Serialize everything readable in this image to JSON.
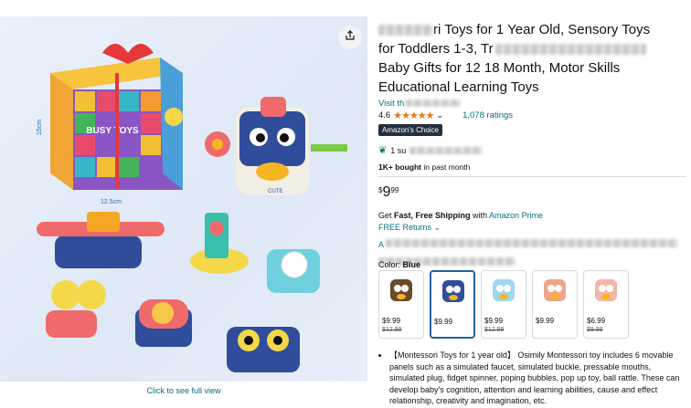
{
  "gallery": {
    "full_view_link": "Click to see full view",
    "share_icon": "share-icon"
  },
  "product": {
    "title": "ri Toys for 1 Year Old, Sensory Toys for Toddlers 1-3, Tr Baby Gifts for 12 18 Month, Motor Skills Educational Learning Toys",
    "title_lines": [
      "ri Toys for 1 Year Old, Sensory Toys",
      "for Toddlers 1-3, Tr",
      "Baby Gifts for 12 18 Month, Motor Skills",
      "Educational Learning Toys"
    ],
    "visit_store": "Visit th",
    "rating_value": "4.6",
    "stars": "★★★★★",
    "ratings_count": "1,078 ratings",
    "badge": "Amazon's Choice",
    "sustainability": "1 su",
    "bought": "1K+ bought",
    "bought_suffix": "in past month",
    "price_currency": "$",
    "price_whole": "9",
    "price_fraction": "99",
    "shipping_prefix": "Get ",
    "shipping_bold": "Fast, Free Shipping",
    "shipping_mid": " with ",
    "shipping_link": "Amazon Prime",
    "returns": "FREE Returns",
    "blurred_prefix": "A",
    "color_label": "Color:",
    "color_value": "Blue",
    "swatches": [
      {
        "price": "$9.99",
        "strike": "$12.99",
        "color": "#6b4a2a"
      },
      {
        "price": "$9.99",
        "strike": "",
        "color": "#2f4d9b"
      },
      {
        "price": "$9.99",
        "strike": "$12.99",
        "color": "#9fd6f0"
      },
      {
        "price": "$9.99",
        "strike": "",
        "color": "#f0a38a"
      },
      {
        "price": "$6.99",
        "strike": "$9.99",
        "color": "#f3b6a8"
      }
    ],
    "bullet": "【Montessori Toys for 1 year old】 Osimily Montessori toy includes 6 movable panels such as a simulated faucet, simulated buckle, pressable mouths, simulated plug, fidget spinner, poping bubbles, pop up toy, ball rattle. These can develop baby's cognition, attention and learning abilities, cause and effect relationship, creativity and imagination, etc."
  },
  "image_labels": {
    "box_brand": "BUSY TOYS",
    "dim_width": "12.5cm",
    "dim_height": "15cm",
    "dim_depth": "12.5cm",
    "cube_label": "CUTE"
  }
}
